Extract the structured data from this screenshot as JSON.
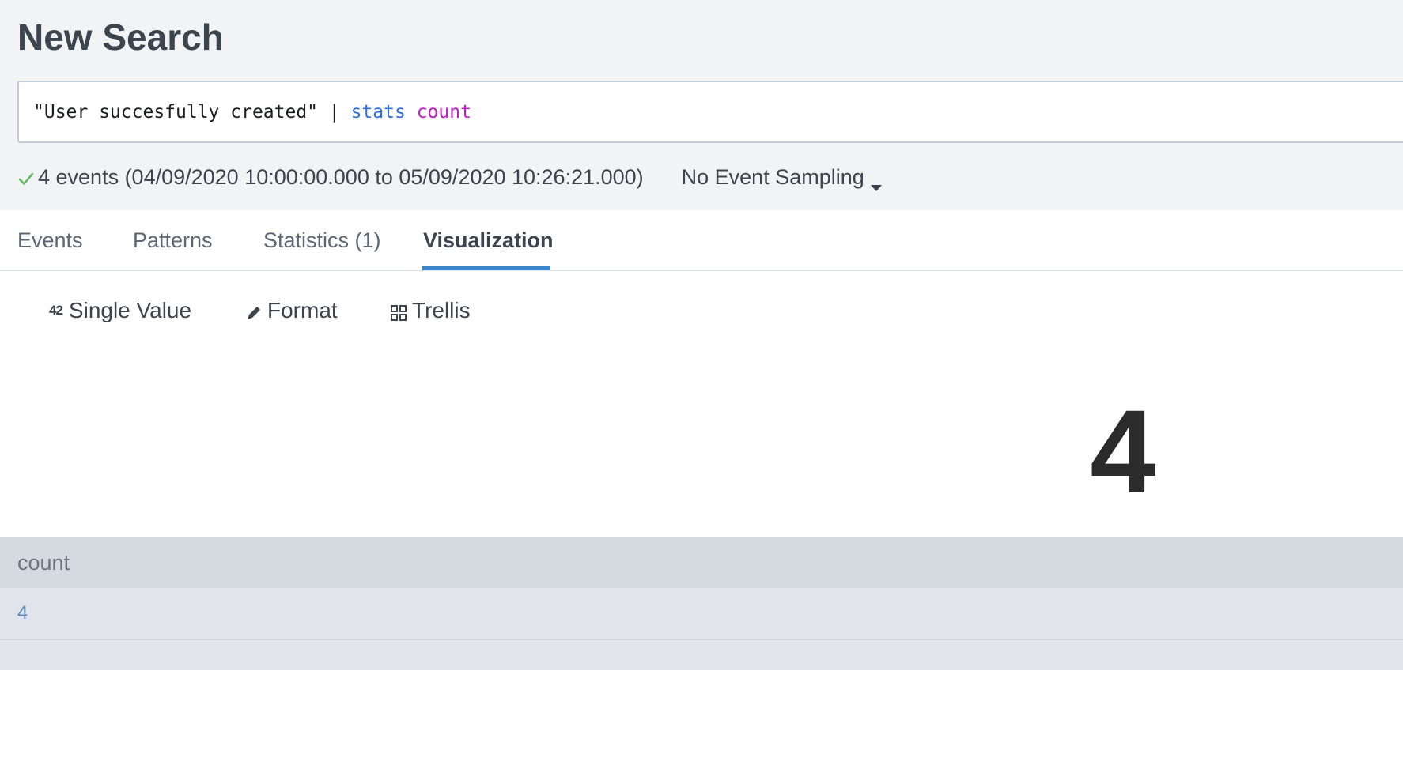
{
  "header": {
    "title": "New Search"
  },
  "search": {
    "query_text": "\"User succesfully created\" | ",
    "query_command": "stats",
    "query_function": "count"
  },
  "status": {
    "events_text": "4 events (04/09/2020 10:00:00.000 to 05/09/2020 10:26:21.000)",
    "sampling_label": "No Event Sampling",
    "check_color": "#5cb85c"
  },
  "tabs": [
    {
      "label": "Events",
      "active": false
    },
    {
      "label": "Patterns",
      "active": false
    },
    {
      "label": "Statistics (1)",
      "active": false
    },
    {
      "label": "Visualization",
      "active": true
    }
  ],
  "viz_toolbar": {
    "single_value_icon": "42",
    "single_value_label": "Single Value",
    "format_label": "Format",
    "trellis_label": "Trellis"
  },
  "visualization": {
    "value": "4"
  },
  "table": {
    "columns": [
      "count"
    ],
    "rows": [
      [
        "4"
      ]
    ]
  },
  "colors": {
    "accent": "#3a86c8",
    "query_command": "#2f6fdf",
    "query_function": "#c11cc8"
  }
}
